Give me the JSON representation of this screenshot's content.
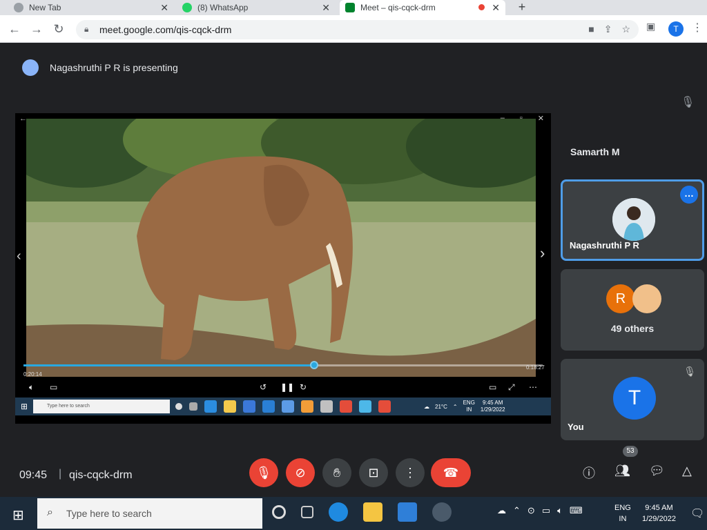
{
  "browser": {
    "tabs": [
      {
        "title": "New Tab",
        "favicon_color": "#9aa0a6"
      },
      {
        "title": "(8) WhatsApp",
        "favicon_color": "#25d366"
      },
      {
        "title": "Meet – qis-cqck-drm",
        "favicon_color": "#00832d"
      }
    ],
    "url": "meet.google.com/qis-cqck-drm",
    "profile_initial": "T",
    "nav_icons": [
      "back-arrow-icon",
      "forward-arrow-icon",
      "reload-icon"
    ]
  },
  "meet": {
    "presenter_text": "Nagashruthi P R is presenting",
    "video": {
      "elapsed": "0:20:14",
      "duration": "0:18:27",
      "progress": 0.56
    },
    "inner_taskbar": {
      "search_placeholder": "Type here to search",
      "weather": "21°C",
      "lang_top": "ENG",
      "lang_bottom": "IN",
      "time": "9:45 AM",
      "date": "1/29/2022"
    },
    "participants": {
      "top_name": "Samarth M",
      "featured": {
        "name": "Nagashruthi P R"
      },
      "others": {
        "initial": "R",
        "label": "49 others"
      },
      "you": {
        "initial": "T",
        "name": "You"
      }
    },
    "bottom": {
      "time": "09:45",
      "separator": "|",
      "code": "qis-cqck-drm",
      "participant_count": "53"
    }
  },
  "taskbar": {
    "search_placeholder": "Type here to search",
    "lang_top": "ENG",
    "lang_bottom": "IN",
    "time": "9:45 AM",
    "date": "1/29/2022"
  },
  "colors": {
    "accent_blue": "#1a73e8",
    "danger_red": "#ea4335",
    "meet_bg": "#202124",
    "progress_blue": "#29a8e0"
  }
}
